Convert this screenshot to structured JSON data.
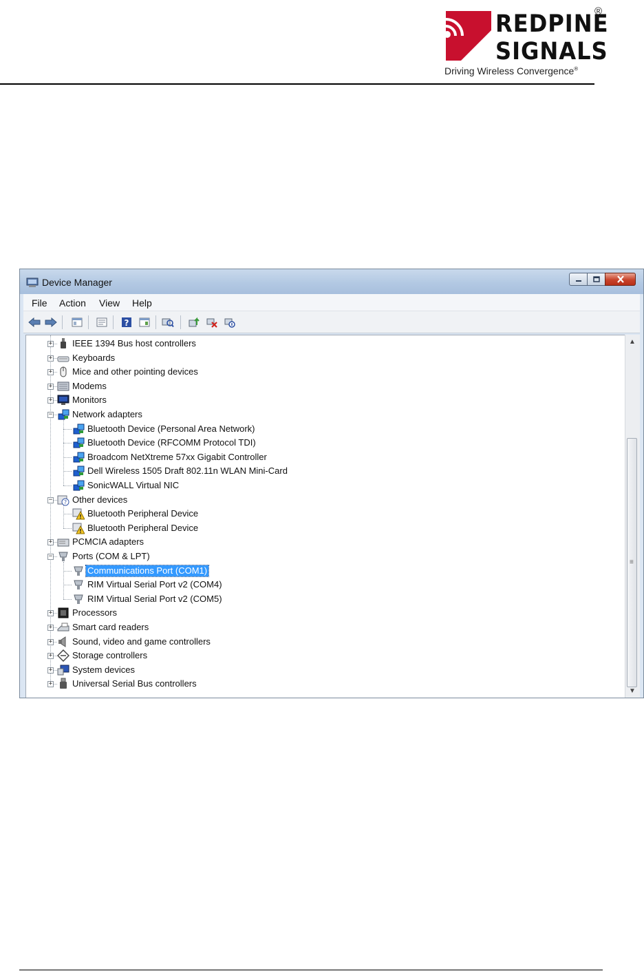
{
  "header": {
    "brand_line1": "REDPINE",
    "brand_line2": "SIGNALS",
    "registered_mark": "®",
    "tagline": "Driving Wireless Convergence",
    "tagline_mark": "®",
    "brand_color": "#c8102e"
  },
  "window": {
    "title": "Device Manager",
    "minimize_icon": "minimize-icon",
    "maximize_icon": "maximize-icon",
    "close_icon": "close-icon"
  },
  "menu": [
    "File",
    "Action",
    "View",
    "Help"
  ],
  "toolbar": {
    "buttons": [
      "back-icon",
      "forward-icon",
      "show-hide-console-tree-icon",
      "properties-icon",
      "help-icon",
      "action-pane-icon",
      "scan-hardware-changes-icon",
      "update-driver-icon",
      "uninstall-icon",
      "disable-device-icon"
    ]
  },
  "tree": {
    "nodes": [
      {
        "label": "IEEE 1394 Bus host controllers",
        "level": 0,
        "expanded": false,
        "icon": "bus-controller-icon"
      },
      {
        "label": "Keyboards",
        "level": 0,
        "expanded": false,
        "icon": "keyboard-icon"
      },
      {
        "label": "Mice and other pointing devices",
        "level": 0,
        "expanded": false,
        "icon": "mouse-icon"
      },
      {
        "label": "Modems",
        "level": 0,
        "expanded": false,
        "icon": "modem-icon"
      },
      {
        "label": "Monitors",
        "level": 0,
        "expanded": false,
        "icon": "monitor-icon"
      },
      {
        "label": "Network adapters",
        "level": 0,
        "expanded": true,
        "icon": "network-adapter-icon"
      },
      {
        "label": "Bluetooth Device (Personal Area Network)",
        "level": 1,
        "icon": "network-adapter-icon"
      },
      {
        "label": "Bluetooth Device (RFCOMM Protocol TDI)",
        "level": 1,
        "icon": "network-adapter-icon"
      },
      {
        "label": "Broadcom NetXtreme 57xx Gigabit Controller",
        "level": 1,
        "icon": "network-adapter-icon"
      },
      {
        "label": "Dell Wireless 1505 Draft 802.11n WLAN Mini-Card",
        "level": 1,
        "icon": "network-adapter-icon"
      },
      {
        "label": "SonicWALL Virtual NIC",
        "level": 1,
        "icon": "network-adapter-icon"
      },
      {
        "label": "Other devices",
        "level": 0,
        "expanded": true,
        "icon": "unknown-device-icon"
      },
      {
        "label": "Bluetooth Peripheral Device",
        "level": 1,
        "icon": "warning-device-icon"
      },
      {
        "label": "Bluetooth Peripheral Device",
        "level": 1,
        "icon": "warning-device-icon"
      },
      {
        "label": "PCMCIA adapters",
        "level": 0,
        "expanded": false,
        "icon": "pcmcia-icon"
      },
      {
        "label": "Ports (COM & LPT)",
        "level": 0,
        "expanded": true,
        "icon": "port-icon"
      },
      {
        "label": "Communications Port (COM1)",
        "level": 1,
        "icon": "port-icon",
        "selected": true
      },
      {
        "label": "RIM Virtual Serial Port v2 (COM4)",
        "level": 1,
        "icon": "port-icon"
      },
      {
        "label": "RIM Virtual Serial Port v2 (COM5)",
        "level": 1,
        "icon": "port-icon"
      },
      {
        "label": "Processors",
        "level": 0,
        "expanded": false,
        "icon": "processor-icon"
      },
      {
        "label": "Smart card readers",
        "level": 0,
        "expanded": false,
        "icon": "smart-card-reader-icon"
      },
      {
        "label": "Sound, video and game controllers",
        "level": 0,
        "expanded": false,
        "icon": "speaker-icon"
      },
      {
        "label": "Storage controllers",
        "level": 0,
        "expanded": false,
        "icon": "storage-controller-icon"
      },
      {
        "label": "System devices",
        "level": 0,
        "expanded": false,
        "icon": "system-device-icon"
      },
      {
        "label": "Universal Serial Bus controllers",
        "level": 0,
        "expanded": false,
        "icon": "usb-icon"
      }
    ],
    "selection_color": "#3399ff"
  },
  "scrollbar": {
    "up_arrow": "▲",
    "down_arrow": "▼",
    "grip": "≡"
  }
}
